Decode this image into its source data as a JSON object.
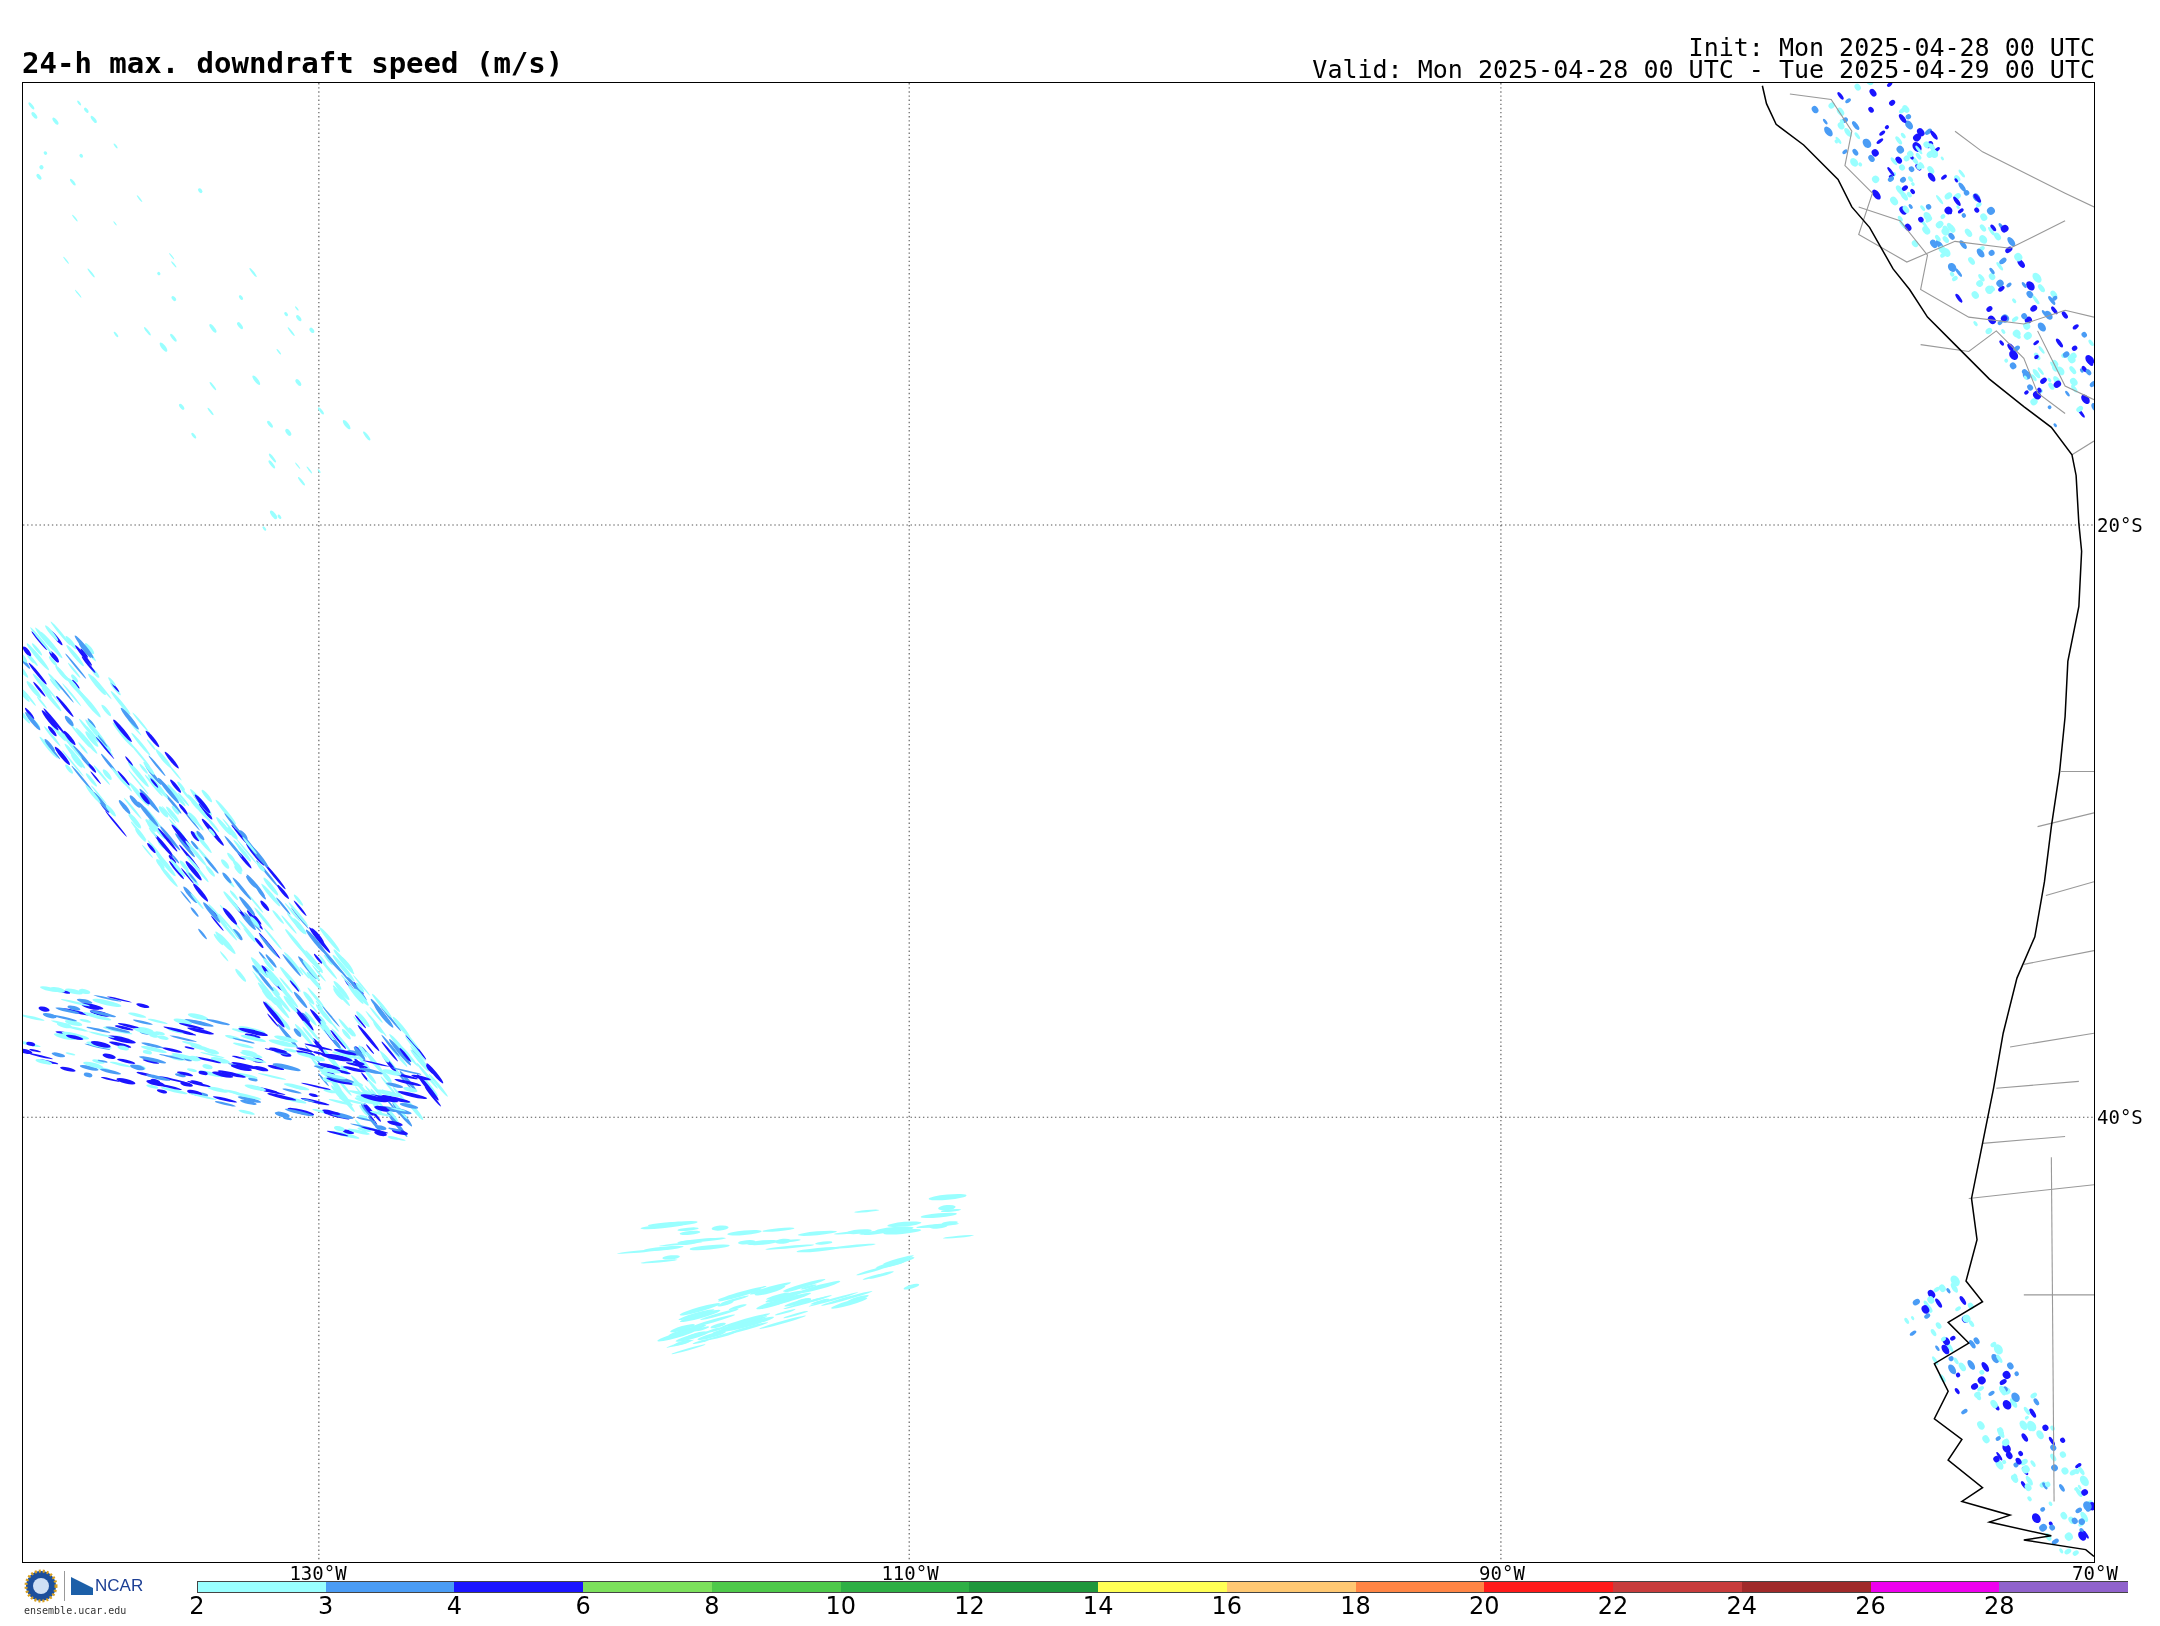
{
  "title": "24-h max. downdraft speed (m/s)",
  "init": "Init: Mon 2025-04-28 00 UTC",
  "valid": "Valid: Mon 2025-04-28 00 UTC - Tue 2025-04-29 00 UTC",
  "map": {
    "latitude_labels": [
      "20°S",
      "40°S"
    ],
    "longitude_labels": [
      "130°W",
      "110°W",
      "90°W",
      "70°W"
    ]
  },
  "colorbar": {
    "segments": [
      {
        "label": "2",
        "color": "#99ffff"
      },
      {
        "label": "3",
        "color": "#4a9cf5"
      },
      {
        "label": "4",
        "color": "#1a14ff"
      },
      {
        "label": "6",
        "color": "#7ce05c"
      },
      {
        "label": "8",
        "color": "#4ec94a"
      },
      {
        "label": "10",
        "color": "#2eaf45"
      },
      {
        "label": "12",
        "color": "#1f973c"
      },
      {
        "label": "14",
        "color": "#ffff55"
      },
      {
        "label": "16",
        "color": "#ffc873"
      },
      {
        "label": "18",
        "color": "#ff8545"
      },
      {
        "label": "20",
        "color": "#ff1a1a"
      },
      {
        "label": "22",
        "color": "#c83c3c"
      },
      {
        "label": "24",
        "color": "#a02a2a"
      },
      {
        "label": "26",
        "color": "#ee00ee"
      },
      {
        "label": "28",
        "color": "#9062cc"
      }
    ]
  },
  "logo": {
    "name": "NCAR",
    "url": "ensemble.ucar.edu"
  }
}
